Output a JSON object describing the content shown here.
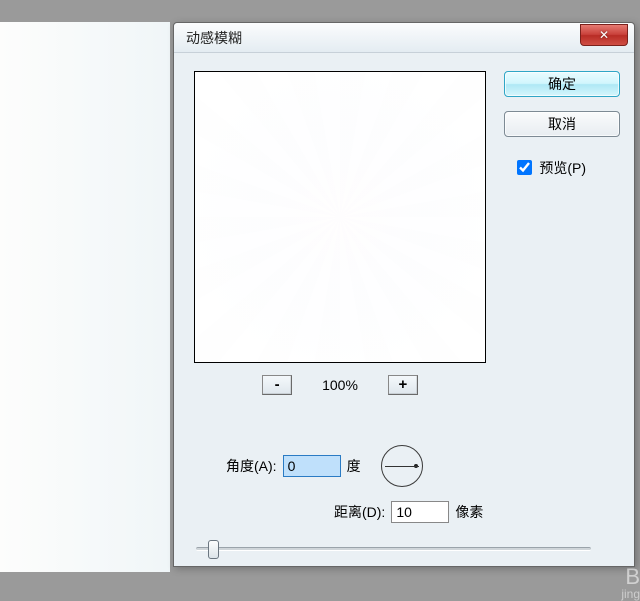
{
  "dialog": {
    "title": "动感模糊",
    "ok_label": "确定",
    "cancel_label": "取消",
    "preview_label": "预览(P)",
    "preview_checked": true,
    "zoom": {
      "out_label": "-",
      "in_label": "+",
      "value": "100%"
    },
    "angle": {
      "label": "角度(A):",
      "value": "0",
      "unit": "度"
    },
    "distance": {
      "label": "距离(D):",
      "value": "10",
      "unit": "像素"
    }
  },
  "watermark": {
    "top": "B",
    "sub": "jing"
  }
}
